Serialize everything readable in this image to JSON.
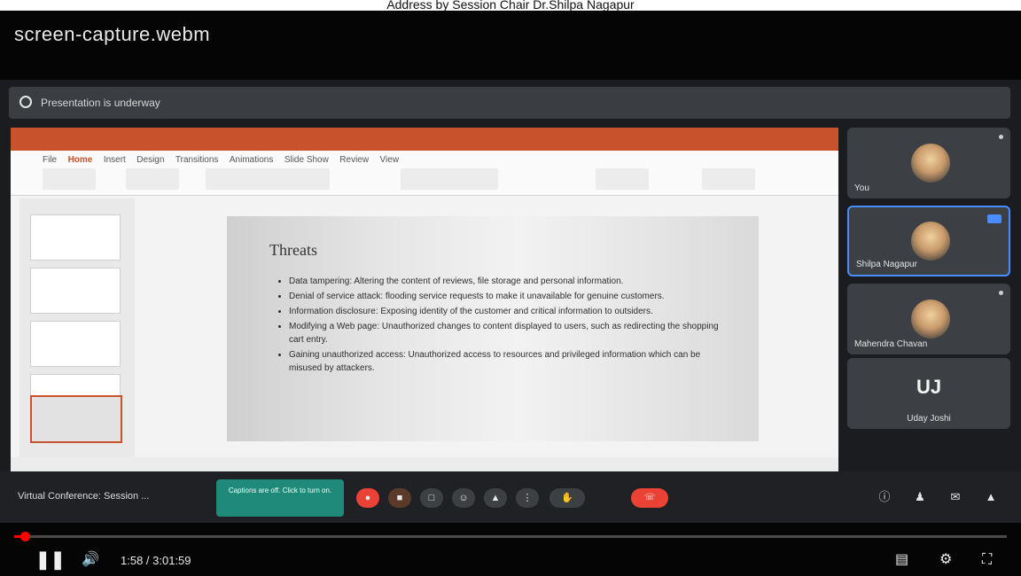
{
  "page": {
    "title": "Address by Session Chair Dr.Shilpa Nagapur"
  },
  "video": {
    "filename": "screen-capture.webm"
  },
  "presentation_banner": {
    "text": "Presentation is underway"
  },
  "powerpoint": {
    "tabs": [
      "File",
      "Home",
      "Insert",
      "Design",
      "Transitions",
      "Animations",
      "Slide Show",
      "Review",
      "View"
    ],
    "slide": {
      "title": "Threats",
      "bullets": [
        "Data tampering: Altering the content of reviews, file storage and personal information.",
        "Denial of service attack: flooding service requests to make it unavailable for genuine customers.",
        "Information disclosure: Exposing identity of the customer and critical information to outsiders.",
        "Modifying a Web page: Unauthorized changes to content displayed to users, such as redirecting the shopping cart entry.",
        "Gaining unauthorized access: Unauthorized access to resources and privileged information which can be misused by attackers."
      ]
    }
  },
  "participants": [
    {
      "name": "You"
    },
    {
      "name": "Shilpa Nagapur"
    },
    {
      "name": "Mahendra Chavan"
    },
    {
      "name": "Uday Joshi",
      "initials": "UJ"
    }
  ],
  "meeting": {
    "name": "Virtual Conference: Session ...",
    "caption_box": "Captions are off. Click to turn on.",
    "end_label": "End"
  },
  "player": {
    "time": "1:58 / 3:01:59",
    "progress_fraction": 0.011
  }
}
